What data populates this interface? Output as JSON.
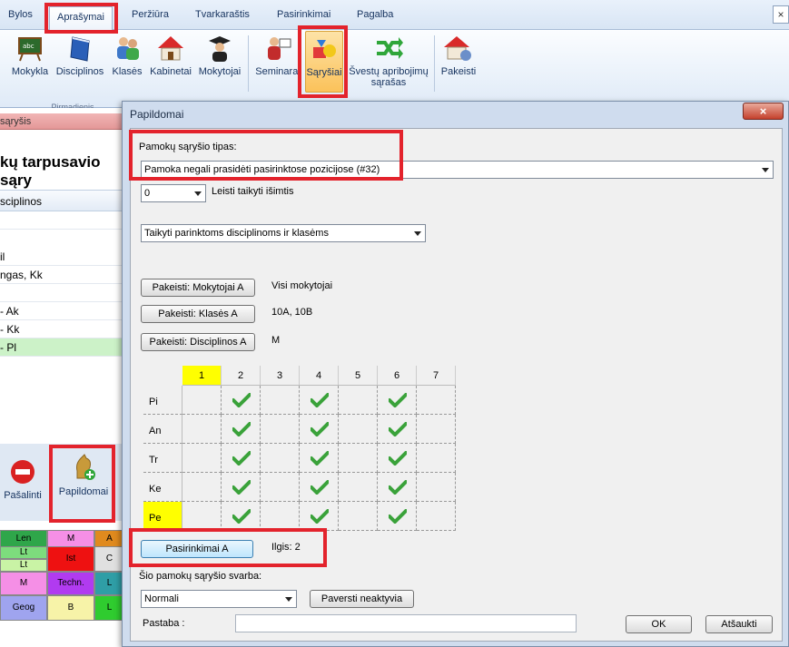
{
  "menu": {
    "items": [
      "Bylos",
      "Aprašymai",
      "Peržiūra",
      "Tvarkaraštis",
      "Pasirinkimai",
      "Pagalba"
    ],
    "active": "Aprašymai"
  },
  "ribbon": {
    "buttons": [
      "Mokykla",
      "Disciplinos",
      "Klasės",
      "Kabinetai",
      "Mokytojai",
      "Seminarai",
      "Sąryšiai",
      "Švestų apribojimų",
      "Pakeisti"
    ],
    "buttons_line2": {
      "avoid": "sąrašas"
    },
    "group_label": "Pirmadienis"
  },
  "left_pane": {
    "tab": "sąryšis",
    "title": "kų tarpusavio sąry",
    "column_header": "sciplinos",
    "rows": [
      "",
      "il",
      "ngas, Kk",
      "",
      " - Ak",
      " - Kk",
      " - Pl"
    ],
    "remove_label": "Pašalinti",
    "additional_label": "Papildomai",
    "timetable": [
      [
        {
          "t": "Len",
          "c": "#2fa64a"
        },
        {
          "t": "M",
          "c": "#f58fe6"
        },
        {
          "t": "A",
          "c": "#e08a1e"
        }
      ],
      [
        {
          "t": "Lt",
          "c": "#7ddc7d"
        },
        {
          "t": "Ist",
          "c": "#ee1111"
        },
        {
          "t": "C",
          "c": "#e0e0e0"
        }
      ],
      [
        {
          "t": "Lt",
          "c": "#c9f3a5"
        },
        {
          "t": "",
          "c": "#ee1111"
        },
        {
          "t": "",
          "c": "#e0e0e0"
        }
      ],
      [
        {
          "t": "M",
          "c": "#f58fe6"
        },
        {
          "t": "Techn.",
          "c": "#b13bf0"
        },
        {
          "t": "L",
          "c": "#2f9ea6"
        }
      ],
      [
        {
          "t": "Geog",
          "c": "#9fa4ef"
        },
        {
          "t": "B",
          "c": "#f7f3a8"
        },
        {
          "t": "L",
          "c": "#2fcc2f"
        }
      ]
    ]
  },
  "dialog": {
    "title": "Papildomai",
    "relation_type_label": "Pamokų sąryšio tipas:",
    "relation_type_value": "Pamoka negali prasidėti pasirinktose pozicijose (#32)",
    "exception_value": "0",
    "exception_label": "Leisti taikyti išimtis",
    "apply_value": "Taikyti parinktoms disciplinoms ir klasėms",
    "change_teachers_btn": "Pakeisti: Mokytojai A",
    "teachers_value": "Visi mokytojai",
    "change_classes_btn": "Pakeisti: Klasės A",
    "classes_value": "10A, 10B",
    "change_subjects_btn": "Pakeisti: Disciplinos A",
    "subjects_value": "M",
    "grid": {
      "columns": [
        "1",
        "2",
        "3",
        "4",
        "5",
        "6",
        "7"
      ],
      "highlight_column": "1",
      "rows": [
        "Pi",
        "An",
        "Tr",
        "Ke",
        "Pe"
      ],
      "highlight_row": "Pe",
      "checked": [
        [
          false,
          true,
          false,
          true,
          false,
          true,
          false
        ],
        [
          false,
          true,
          false,
          true,
          false,
          true,
          false
        ],
        [
          false,
          true,
          false,
          true,
          false,
          true,
          false
        ],
        [
          false,
          true,
          false,
          true,
          false,
          true,
          false
        ],
        [
          false,
          true,
          false,
          true,
          false,
          true,
          false
        ]
      ]
    },
    "selections_btn": "Pasirinkimai A",
    "length_label": "Ilgis: 2",
    "weight_label": "Šio pamokų sąryšio svarba:",
    "weight_value": "Normali",
    "deactivate_btn": "Paversti neaktyvia",
    "note_label": "Pastaba :",
    "note_value": "",
    "ok_btn": "OK",
    "cancel_btn": "Atšaukti"
  },
  "colors": {
    "highlight": "#e3232c",
    "check": "#3aa23a",
    "yellow": "#ffff00"
  }
}
